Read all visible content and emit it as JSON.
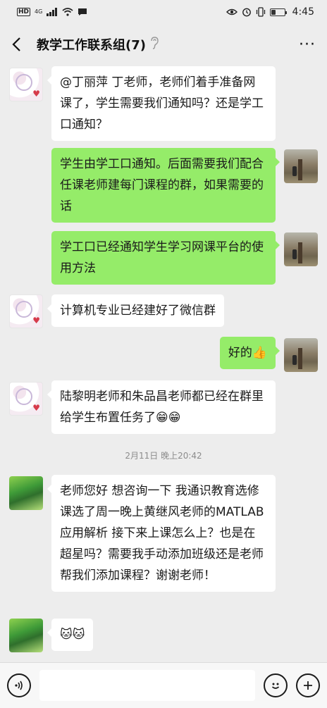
{
  "status_bar": {
    "hd": "HD",
    "network": "4G",
    "time": "4:45",
    "battery_level": 0.35
  },
  "header": {
    "title": "教学工作联系组(7)",
    "back_icon": "chevron-left-icon",
    "mute_icon": "ear-icon",
    "more_label": "···"
  },
  "messages": [
    {
      "side": "left",
      "text": "@丁丽萍  丁老师，老师们着手准备网课了，学生需要我们通知吗？还是学工口通知？"
    },
    {
      "side": "right",
      "text": "学生由学工口通知。后面需要我们配合任课老师建每门课程的群，如果需要的话"
    },
    {
      "side": "right",
      "text": "学工口已经通知学生学习网课平台的使用方法"
    },
    {
      "side": "left",
      "text": "计算机专业已经建好了微信群"
    },
    {
      "side": "right",
      "text": "好的👍"
    },
    {
      "side": "left",
      "text": "陆黎明老师和朱品昌老师都已经在群里给学生布置任务了😁😁"
    },
    {
      "side": "left",
      "text": "老师您好 想咨询一下 我通识教育选修课选了周一晚上黄继风老师的MATLAB 应用解析 接下来上课怎么上？也是在超星吗？需要我手动添加班级还是老师帮我们添加课程？谢谢老师！"
    },
    {
      "side": "left",
      "text": "🐱🐱"
    }
  ],
  "timestamp": "2月11日 晚上20:42",
  "input_bar": {
    "voice_icon": "voice-icon",
    "emoji_icon": "emoji-icon",
    "plus_icon": "plus-icon"
  }
}
